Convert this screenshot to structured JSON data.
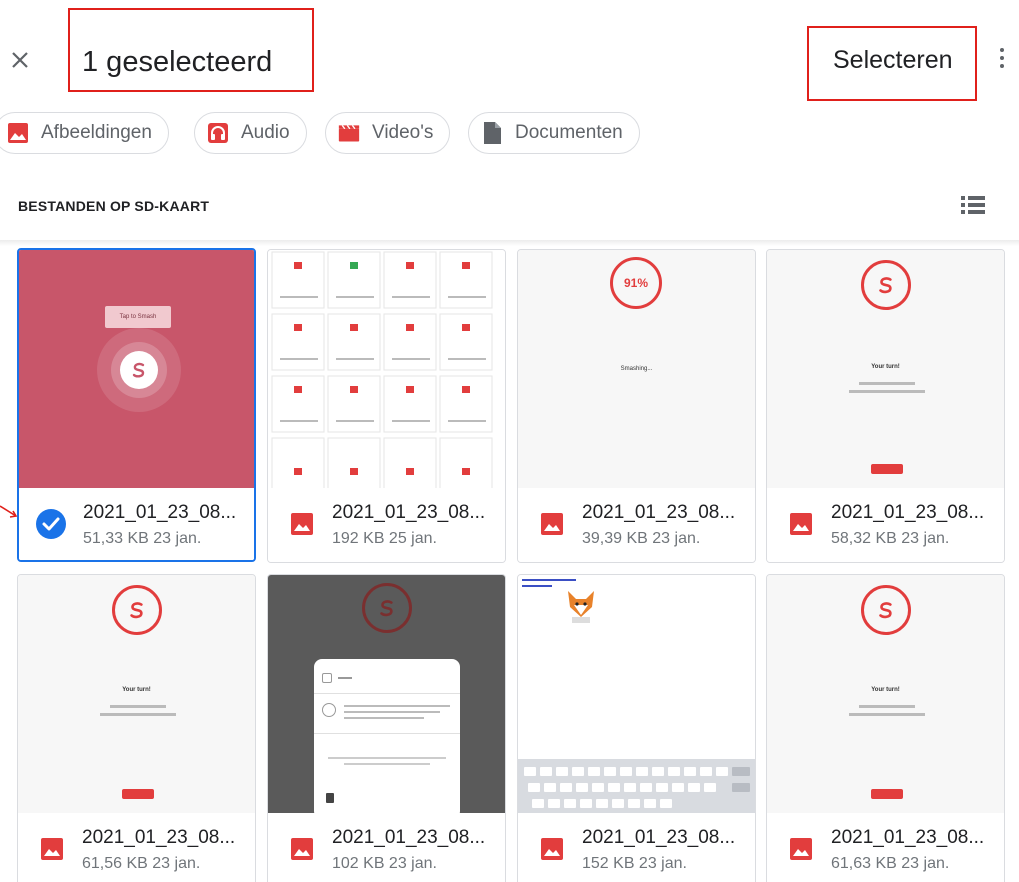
{
  "header": {
    "title": "1 geselecteerd",
    "select_label": "Selecteren"
  },
  "chips": [
    {
      "label": "Afbeeldingen",
      "icon": "image-icon",
      "color": "#e23d3d"
    },
    {
      "label": "Audio",
      "icon": "headphones-icon",
      "color": "#e23d3d"
    },
    {
      "label": "Video's",
      "icon": "clapperboard-icon",
      "color": "#e23d3d"
    },
    {
      "label": "Documenten",
      "icon": "document-icon",
      "color": "#5f6368"
    }
  ],
  "section": {
    "title": "BESTANDEN OP SD-KAART"
  },
  "files": [
    {
      "name": "2021_01_23_08...",
      "meta": "51,33 KB 23 jan.",
      "selected": true,
      "thumb_caption": "Tap to Smash"
    },
    {
      "name": "2021_01_23_08...",
      "meta": "192 KB 25 jan.",
      "selected": false
    },
    {
      "name": "2021_01_23_08...",
      "meta": "39,39 KB 23 jan.",
      "selected": false,
      "thumb_percent": "91%",
      "thumb_caption": "Smashing..."
    },
    {
      "name": "2021_01_23_08...",
      "meta": "58,32 KB 23 jan.",
      "selected": false,
      "thumb_caption": "Your turn!"
    },
    {
      "name": "2021_01_23_08...",
      "meta": "61,56 KB 23 jan.",
      "selected": false,
      "thumb_caption": "Your turn!"
    },
    {
      "name": "2021_01_23_08...",
      "meta": "102 KB 23 jan.",
      "selected": false
    },
    {
      "name": "2021_01_23_08...",
      "meta": "152 KB 23 jan.",
      "selected": false
    },
    {
      "name": "2021_01_23_08...",
      "meta": "61,63 KB 23 jan.",
      "selected": false,
      "thumb_caption": "Your turn!"
    }
  ],
  "colors": {
    "accent_red": "#e23d3d",
    "selection_blue": "#1a73e8",
    "annotation_red": "#e0201b"
  }
}
